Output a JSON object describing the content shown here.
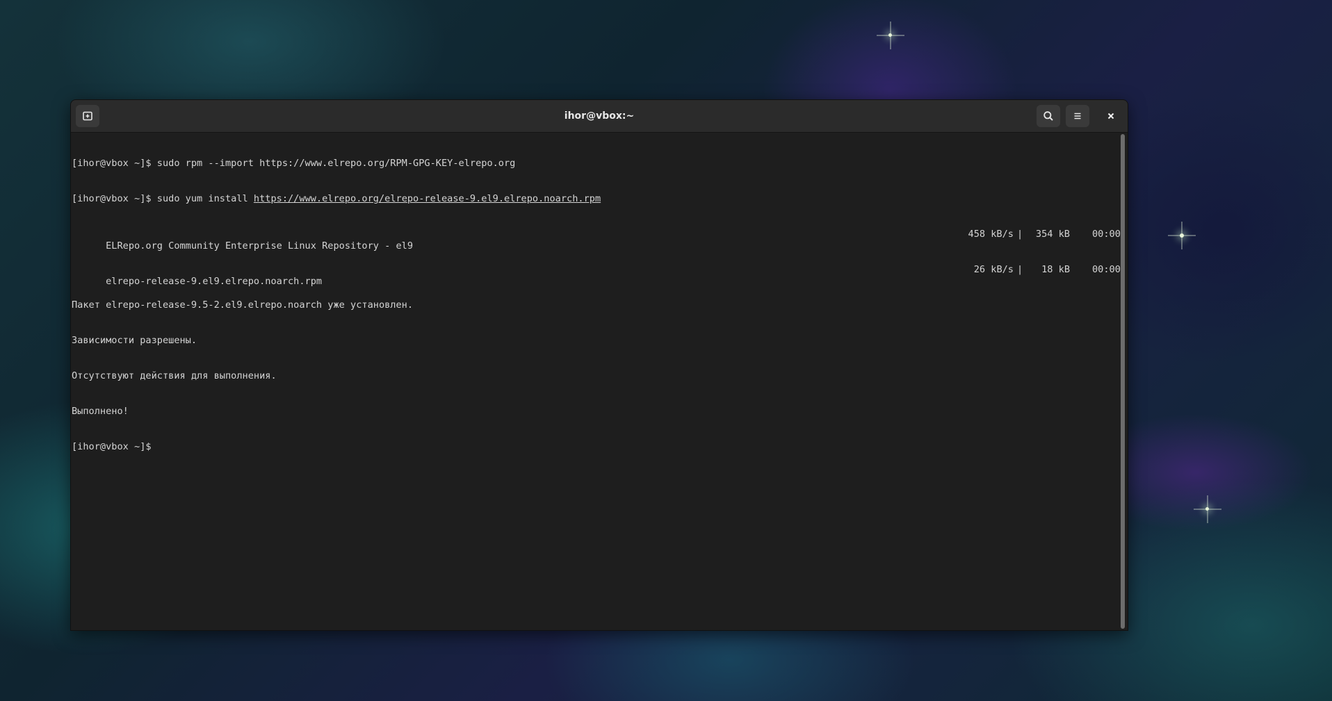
{
  "window": {
    "title": "ihor@vbox:~"
  },
  "icons": {
    "new_tab": "new-tab-icon",
    "search": "search-icon",
    "menu": "hamburger-menu-icon",
    "close": "close-icon"
  },
  "terminal": {
    "line1": "[ihor@vbox ~]$ sudo rpm --import https://www.elrepo.org/RPM-GPG-KEY-elrepo.org",
    "line2_prompt": "[ihor@vbox ~]$ sudo yum install ",
    "line2_url": "https://www.elrepo.org/elrepo-release-9.el9.elrepo.noarch.rpm",
    "line3": {
      "text": "ELRepo.org Community Enterprise Linux Repository - el9",
      "speed": "458 kB/s",
      "sep": "|",
      "size": "354 kB",
      "time": "00:00"
    },
    "line4": {
      "text": "elrepo-release-9.el9.elrepo.noarch.rpm",
      "speed": "26 kB/s",
      "sep": "|",
      "size": "18 kB",
      "time": "00:00"
    },
    "line5": "Пакет elrepo-release-9.5-2.el9.elrepo.noarch уже установлен.",
    "line6": "Зависимости разрешены.",
    "line7": "Отсутствуют действия для выполнения.",
    "line8": "Выполнено!",
    "line9": "[ihor@vbox ~]$"
  },
  "colors": {
    "terminal_bg": "#1e1e1e",
    "headerbar_bg": "#2b2b2b",
    "text": "#d4d4d4"
  }
}
